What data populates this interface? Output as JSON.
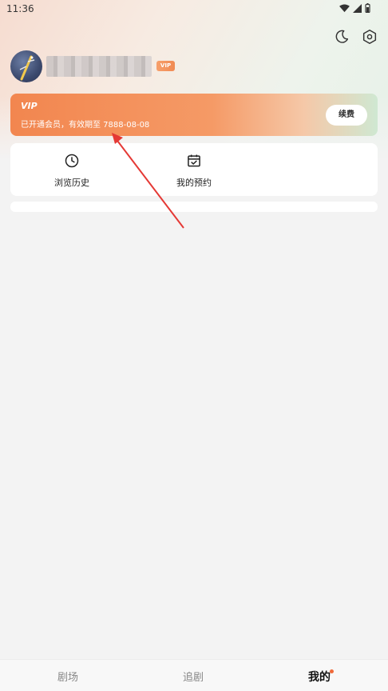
{
  "status_bar": {
    "time": "11:36",
    "icons": [
      "wifi-icon",
      "signal-icon",
      "battery-icon"
    ]
  },
  "header": {
    "icons": [
      "moon-icon",
      "settings-icon"
    ]
  },
  "profile": {
    "username": "",
    "badge": "VIP"
  },
  "vip_card": {
    "title": "VIP",
    "description": "已开通会员，有效期至 7888-08-08",
    "renew_label": "续费",
    "accent_color": "#f2864f"
  },
  "shortcuts": [
    {
      "label": "浏览历史",
      "icon": "clock-icon"
    },
    {
      "label": "我的预约",
      "icon": "calendar-check-icon"
    }
  ],
  "bottom_nav": {
    "tabs": [
      {
        "label": "剧场",
        "active": false
      },
      {
        "label": "追剧",
        "active": false
      },
      {
        "label": "我的",
        "active": true,
        "has_dot": true
      }
    ]
  },
  "colors": {
    "active_tab": "#111111",
    "inactive_tab": "#888888",
    "notification_dot": "#f0693a",
    "annotation_arrow": "#e53935"
  }
}
